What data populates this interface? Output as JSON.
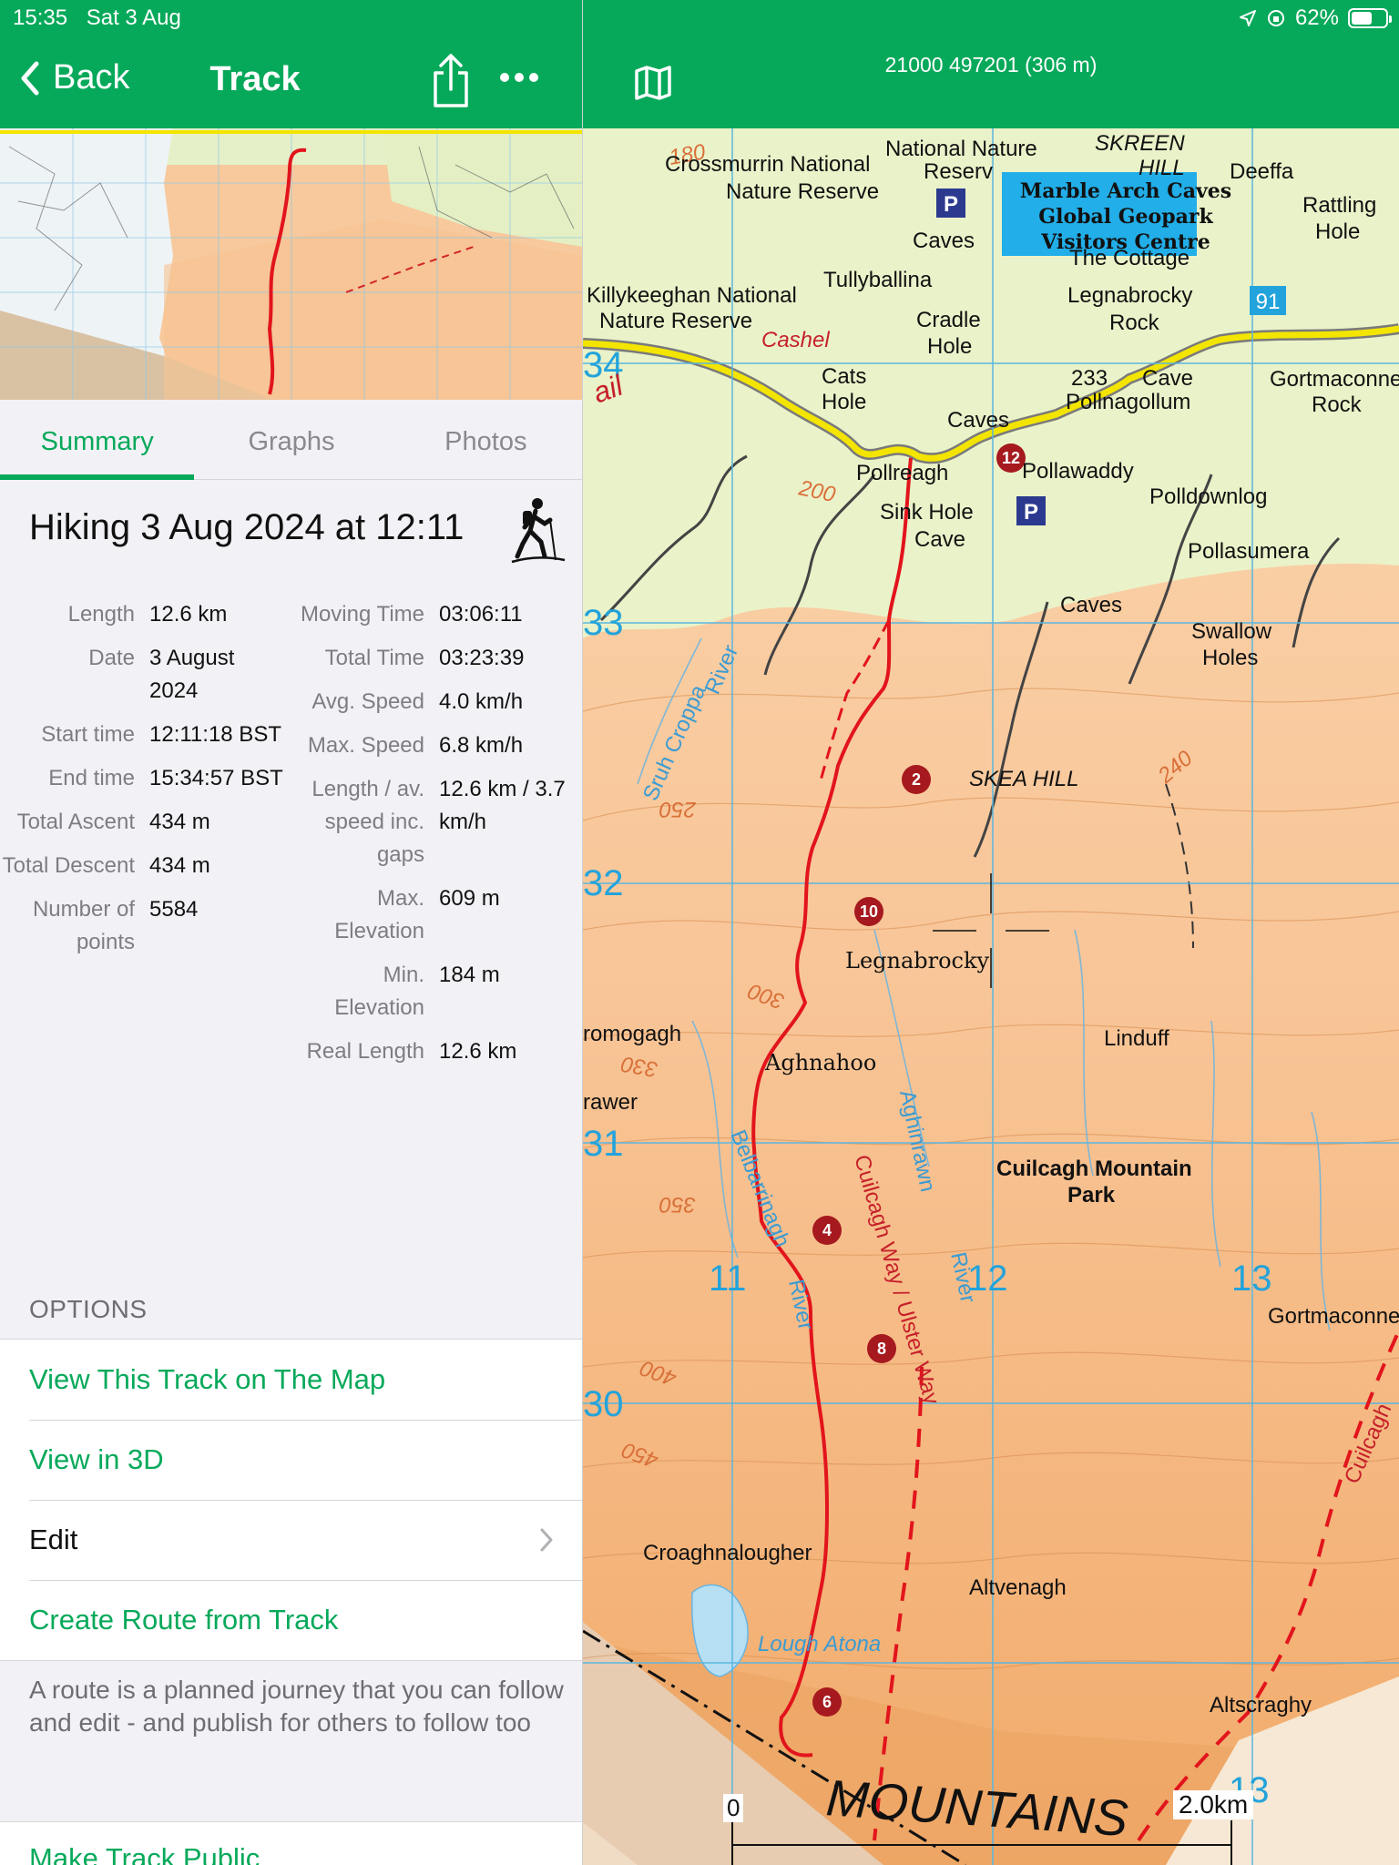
{
  "status": {
    "time": "15:35",
    "date": "Sat 3 Aug",
    "battery": "62%",
    "battery_level": 0.62
  },
  "nav": {
    "back_label": "Back",
    "title": "Track"
  },
  "tabs": [
    "Summary",
    "Graphs",
    "Photos"
  ],
  "track": {
    "title": "Hiking 3 Aug 2024 at 12:11"
  },
  "stats_left": [
    {
      "label": "Length",
      "value": "12.6 km"
    },
    {
      "label": "Date",
      "value": "3 August 2024"
    },
    {
      "label": "Start time",
      "value": "12:11:18 BST"
    },
    {
      "label": "End time",
      "value": "15:34:57 BST"
    },
    {
      "label": "Total Ascent",
      "value": "434 m"
    },
    {
      "label": "Total Descent",
      "value": "434 m"
    },
    {
      "label": "Number of points",
      "value": "5584"
    }
  ],
  "stats_right": [
    {
      "label": "Moving Time",
      "value": "03:06:11"
    },
    {
      "label": "Total Time",
      "value": "03:23:39"
    },
    {
      "label": "Avg. Speed",
      "value": "4.0 km/h"
    },
    {
      "label": "Max. Speed",
      "value": "6.8 km/h"
    },
    {
      "label": "Length / av. speed inc. gaps",
      "value": "12.6 km / 3.7 km/h"
    },
    {
      "label": "Max. Elevation",
      "value": "609 m"
    },
    {
      "label": "Min. Elevation",
      "value": "184 m"
    },
    {
      "label": "Real Length",
      "value": "12.6 km"
    }
  ],
  "options": {
    "header": "OPTIONS",
    "view_map": "View This Track on The Map",
    "view_3d": "View in 3D",
    "edit": "Edit",
    "create_route": "Create Route from Track",
    "route_note": "A route is a planned journey that you can follow and edit - and publish for others to follow too",
    "make_public": "Make Track Public"
  },
  "map": {
    "coords": "21000 497201 (306 m)",
    "scale_start": "0",
    "scale_end": "2.0km",
    "visitor_centre": [
      "Marble Arch Caves",
      "Global Geopark",
      "Visitors Centre"
    ],
    "waypoints": [
      "12",
      "2",
      "10",
      "4",
      "8",
      "6"
    ],
    "place_labels": [
      "Crossmurrin National",
      "Nature Reserve",
      "National Nature",
      "Reserv",
      "SKREEN",
      "HILL",
      "Deeffa",
      "Rattling",
      "Hole",
      "Caves",
      "The Cottage",
      "Tullyballina",
      "Legnabrocky",
      "Rock",
      "Killykeeghan National",
      "Nature Reserve",
      "Cradle",
      "Hole",
      "Cashel",
      "Cats",
      "Hole",
      "233",
      "Cave",
      "Pollnagollum",
      "Gortmaconnell",
      "Rock",
      "Caves",
      "Pollreagh",
      "Pollawaddy",
      "Polldownlog",
      "Sink Hole",
      "Cave",
      "Pollasumera",
      "Caves",
      "Swallow",
      "Holes",
      "SKEA HILL",
      "Legnabrocky",
      "Linduff",
      "Aghnahoo",
      "Cuilcagh Mountain",
      "Park",
      "Gortmaconnell",
      "Croaghnalougher",
      "Altvenagh",
      "Lough Atona",
      "Altscraghy",
      "MOUNTAINS",
      "romogagh",
      "rawer",
      "Sruh Croppa",
      "River",
      "Aghinrawn",
      "River",
      "Belbarrinagh",
      "River",
      "Cuilcagh Way / Ulster Way",
      "Cuilcagh",
      "ail"
    ],
    "grid_labels": [
      "34",
      "33",
      "32",
      "31",
      "30",
      "11",
      "12",
      "13",
      "91",
      "13"
    ],
    "contour_labels": [
      "180",
      "200",
      "250",
      "300",
      "330",
      "350",
      "400",
      "450",
      "240"
    ]
  },
  "colors": {
    "brand_green": "#06a95a",
    "track_red": "#e2141c",
    "waypoint_red": "#a6191e",
    "road_yellow": "#f3e500"
  }
}
